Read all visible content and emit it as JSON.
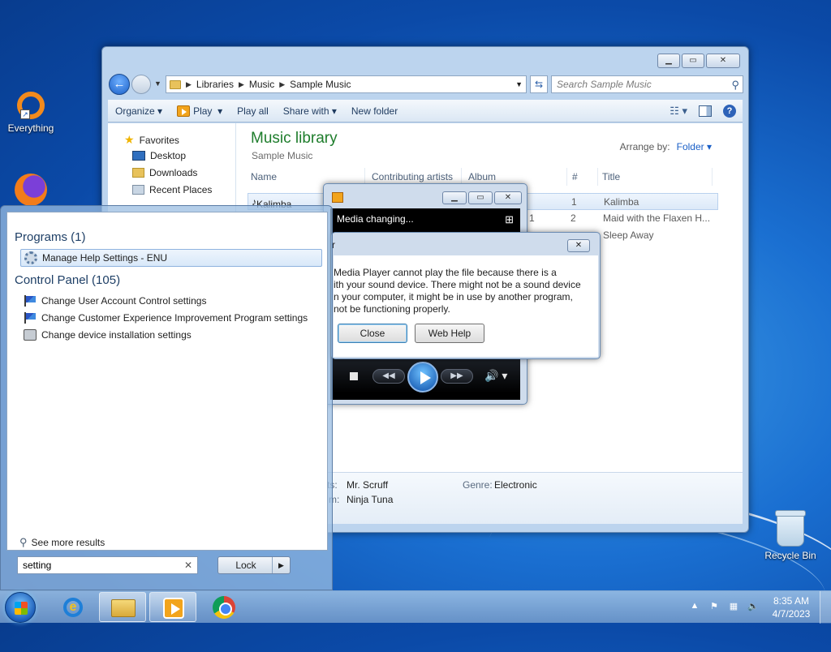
{
  "desktop": {
    "icons": [
      {
        "label": "Everything"
      },
      {
        "label": "Recycle Bin"
      }
    ]
  },
  "explorer": {
    "breadcrumb": [
      "Libraries",
      "Music",
      "Sample Music"
    ],
    "search_placeholder": "Search Sample Music",
    "toolbar": {
      "organize": "Organize",
      "play": "Play",
      "play_all": "Play all",
      "share_with": "Share with",
      "new_folder": "New folder"
    },
    "nav": [
      "Favorites",
      "Desktop",
      "Downloads",
      "Recent Places"
    ],
    "library_title": "Music library",
    "library_subtitle": "Sample Music",
    "arrange_by_label": "Arrange by:",
    "arrange_by_value": "Folder",
    "columns": [
      "Name",
      "Contributing artists",
      "Album",
      "#",
      "Title"
    ],
    "rows": [
      {
        "name": "Kalimba",
        "album": "",
        "num": "1",
        "title": "Kalimba"
      },
      {
        "name": "",
        "album": "ol. 1",
        "num": "2",
        "title": "Maid with the Flaxen H..."
      },
      {
        "name": "",
        "album": "",
        "num": "",
        "title": "Sleep Away"
      }
    ],
    "details": {
      "artist_label": "ts:",
      "artist_value": "Mr. Scruff",
      "album_label": "m:",
      "album_value": "Ninja Tuna",
      "genre_label": "Genre:",
      "genre_value": "Electronic"
    }
  },
  "media_player": {
    "status": "Media changing..."
  },
  "dialog": {
    "title": "r",
    "message": "Media Player cannot play the file because there is a\nith your sound device. There might not be a sound device\nn your computer, it might be in use by another program,\n not be functioning properly.",
    "close_label": "Close",
    "web_help_label": "Web Help"
  },
  "start_menu": {
    "programs_header": "Programs (1)",
    "programs": [
      "Manage Help Settings - ENU"
    ],
    "control_panel_header": "Control Panel (105)",
    "control_panel": [
      "Change User Account Control settings",
      "Change Customer Experience Improvement Program settings",
      "Change device installation settings"
    ],
    "see_more": "See more results",
    "search_value": "setting",
    "lock_label": "Lock"
  },
  "taskbar": {
    "time": "8:35 AM",
    "date": "4/7/2023"
  }
}
